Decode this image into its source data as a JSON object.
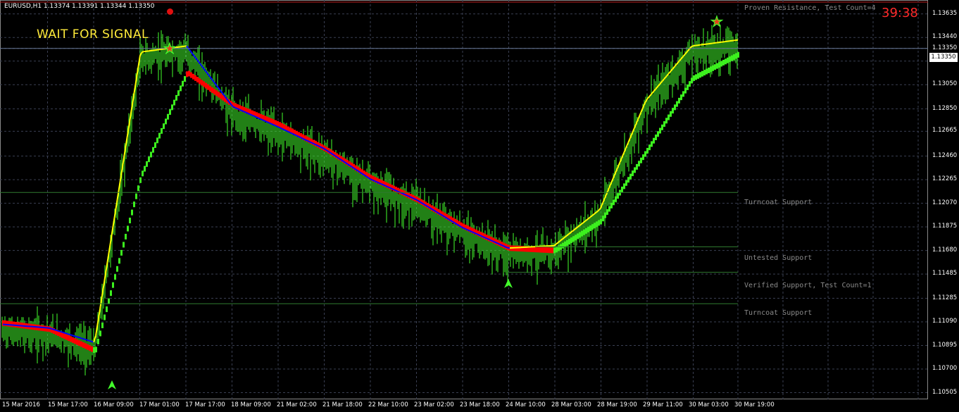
{
  "header": {
    "symbol_info": "EURUSD,H1  1.13374 1.13391 1.13344 1.13350",
    "signal_text": "WAIT FOR SIGNAL",
    "countdown": "39:38"
  },
  "current_price": "1.13350",
  "zones": [
    {
      "label": "Proven Resistance, Test Count=4",
      "price": 1.1371
    },
    {
      "label": "Turncoat Support",
      "price": 1.1216
    },
    {
      "label": "Untested Support",
      "price": 1.1171
    },
    {
      "label": "Verified Support, Test Count=1",
      "price": 1.115
    },
    {
      "label": "Turncoat Support",
      "price": 1.1124
    }
  ],
  "price_axis": [
    "1.13635",
    "1.13440",
    "1.13350",
    "1.13245",
    "1.13050",
    "1.12850",
    "1.12665",
    "1.12460",
    "1.12265",
    "1.12070",
    "1.11875",
    "1.11680",
    "1.11485",
    "1.11285",
    "1.11090",
    "1.10895",
    "1.10700",
    "1.10505"
  ],
  "time_axis": [
    "15 Mar 2016",
    "15 Mar 17:00",
    "16 Mar 09:00",
    "17 Mar 01:00",
    "17 Mar 17:00",
    "18 Mar 09:00",
    "21 Mar 02:00",
    "21 Mar 18:00",
    "22 Mar 10:00",
    "23 Mar 02:00",
    "23 Mar 18:00",
    "24 Mar 10:00",
    "28 Mar 03:00",
    "28 Mar 19:00",
    "29 Mar 11:00",
    "30 Mar 03:00",
    "30 Mar 19:00"
  ],
  "colors": {
    "background": "#000000",
    "grid": "#3a3f52",
    "candles": "#43ff2b",
    "ma_up": "#ffff00",
    "ma_down": "#0000ff",
    "band_down": "#ff0000",
    "band_up": "#3cf01e",
    "countdown": "#ff2a2a",
    "zone_line": "#2f7a2f"
  },
  "chart_data": {
    "type": "line",
    "x": [
      "15 Mar 2016",
      "15 Mar 17:00",
      "16 Mar 09:00",
      "17 Mar 01:00",
      "17 Mar 17:00",
      "18 Mar 09:00",
      "21 Mar 02:00",
      "21 Mar 18:00",
      "22 Mar 10:00",
      "23 Mar 02:00",
      "23 Mar 18:00",
      "24 Mar 10:00",
      "28 Mar 03:00",
      "28 Mar 19:00",
      "29 Mar 11:00",
      "30 Mar 03:00",
      "30 Mar 19:00"
    ],
    "series": [
      {
        "values": [
          1.1105,
          1.1102,
          1.109,
          1.133,
          1.1335,
          1.1285,
          1.1268,
          1.125,
          1.1225,
          1.1208,
          1.1185,
          1.1168,
          1.117,
          1.12,
          1.129,
          1.1335,
          1.134
        ]
      },
      {
        "values": [
          1.1108,
          1.1103,
          1.1085,
          1.123,
          1.1315,
          1.1288,
          1.1272,
          1.1252,
          1.1228,
          1.121,
          1.1188,
          1.117,
          1.1168,
          1.1192,
          1.125,
          1.131,
          1.133
        ]
      }
    ],
    "ylim": [
      1.1045,
      1.1375
    ]
  }
}
